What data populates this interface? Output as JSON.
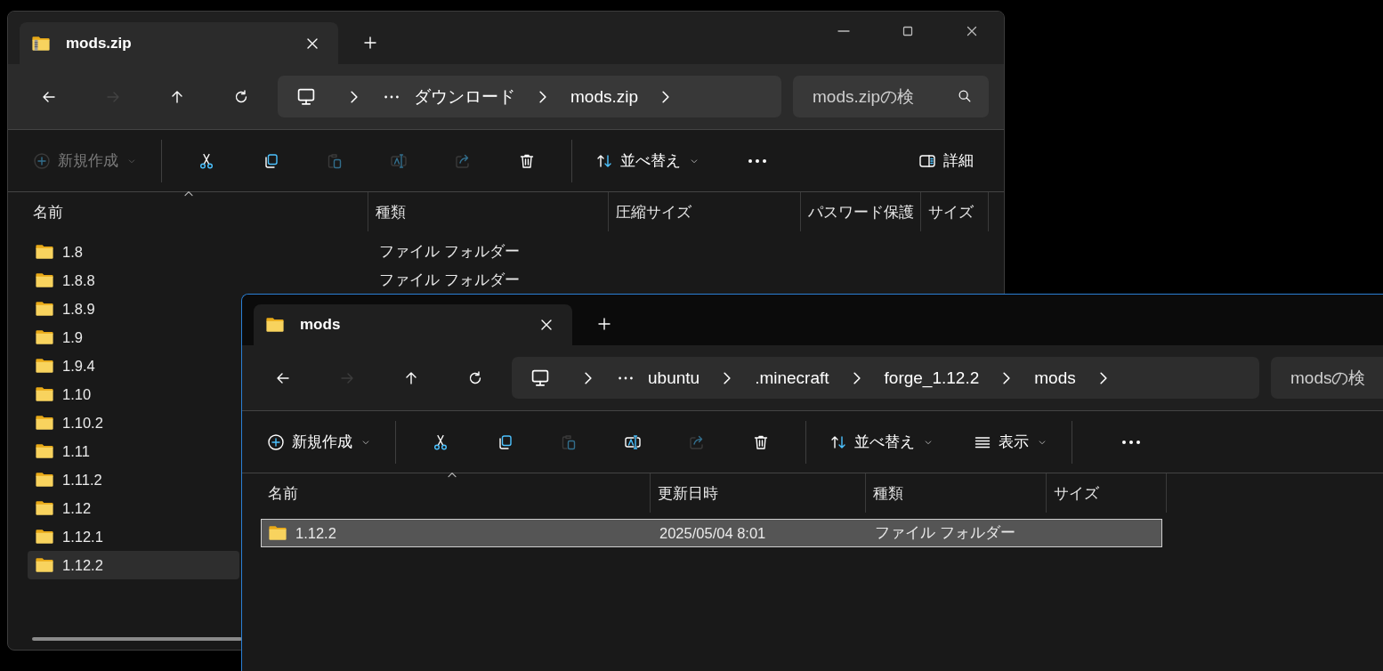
{
  "windows": [
    {
      "kind": "zip",
      "active": false,
      "tab": {
        "title": "mods.zip"
      },
      "window_controls": true,
      "nav": [
        {
          "kind": "back",
          "disabled": false
        },
        {
          "kind": "forward",
          "disabled": true
        },
        {
          "kind": "up",
          "disabled": false
        },
        {
          "kind": "refresh",
          "disabled": false
        }
      ],
      "breadcrumb": [
        "ダウンロード",
        "mods.zip"
      ],
      "search": {
        "placeholder": "mods.zipの検"
      },
      "toolbar": [
        {
          "kind": "new",
          "label": "新規作成",
          "disabled": true
        },
        {
          "kind": "separator"
        },
        {
          "kind": "cut",
          "disabled": false
        },
        {
          "kind": "copy",
          "disabled": false
        },
        {
          "kind": "paste",
          "disabled": true
        },
        {
          "kind": "rename",
          "disabled": true
        },
        {
          "kind": "share",
          "disabled": true
        },
        {
          "kind": "delete",
          "disabled": false
        },
        {
          "kind": "separator"
        },
        {
          "kind": "sort",
          "label": "並べ替え",
          "disabled": false
        },
        {
          "kind": "more",
          "disabled": false
        },
        {
          "kind": "details",
          "label": "詳細",
          "disabled": false
        }
      ],
      "columns": [
        "名前",
        "種類",
        "圧縮サイズ",
        "パスワード保護",
        "サイズ"
      ],
      "rows": [
        {
          "cells": [
            "1.8",
            "ファイル フォルダー"
          ],
          "selected": false
        },
        {
          "cells": [
            "1.8.8",
            "ファイル フォルダー"
          ],
          "selected": false
        },
        {
          "cells": [
            "1.8.9"
          ],
          "selected": false
        },
        {
          "cells": [
            "1.9"
          ],
          "selected": false
        },
        {
          "cells": [
            "1.9.4"
          ],
          "selected": false
        },
        {
          "cells": [
            "1.10"
          ],
          "selected": false
        },
        {
          "cells": [
            "1.10.2"
          ],
          "selected": false
        },
        {
          "cells": [
            "1.11"
          ],
          "selected": false
        },
        {
          "cells": [
            "1.11.2"
          ],
          "selected": false
        },
        {
          "cells": [
            "1.12"
          ],
          "selected": false
        },
        {
          "cells": [
            "1.12.1"
          ],
          "selected": false
        },
        {
          "cells": [
            "1.12.2"
          ],
          "selected": true
        }
      ]
    },
    {
      "kind": "folder",
      "active": true,
      "tab": {
        "title": "mods"
      },
      "window_controls": false,
      "nav": [
        {
          "kind": "back",
          "disabled": false
        },
        {
          "kind": "forward",
          "disabled": true
        },
        {
          "kind": "up",
          "disabled": false
        },
        {
          "kind": "refresh",
          "disabled": false
        }
      ],
      "breadcrumb": [
        "ubuntu",
        ".minecraft",
        "forge_1.12.2",
        "mods"
      ],
      "search": {
        "placeholder": "modsの検"
      },
      "toolbar": [
        {
          "kind": "new",
          "label": "新規作成",
          "disabled": false
        },
        {
          "kind": "separator"
        },
        {
          "kind": "cut",
          "disabled": false
        },
        {
          "kind": "copy",
          "disabled": false
        },
        {
          "kind": "paste",
          "disabled": true
        },
        {
          "kind": "rename",
          "disabled": false
        },
        {
          "kind": "share",
          "disabled": true
        },
        {
          "kind": "delete",
          "disabled": false
        },
        {
          "kind": "separator"
        },
        {
          "kind": "sort",
          "label": "並べ替え",
          "disabled": false
        },
        {
          "kind": "view",
          "label": "表示",
          "disabled": false
        },
        {
          "kind": "separator"
        },
        {
          "kind": "more",
          "disabled": false
        }
      ],
      "columns": [
        "名前",
        "更新日時",
        "種類",
        "サイズ"
      ],
      "rows": [
        {
          "cells": [
            "1.12.2",
            "2025/05/04 8:01",
            "ファイル フォルダー"
          ],
          "selected": true
        }
      ]
    }
  ]
}
